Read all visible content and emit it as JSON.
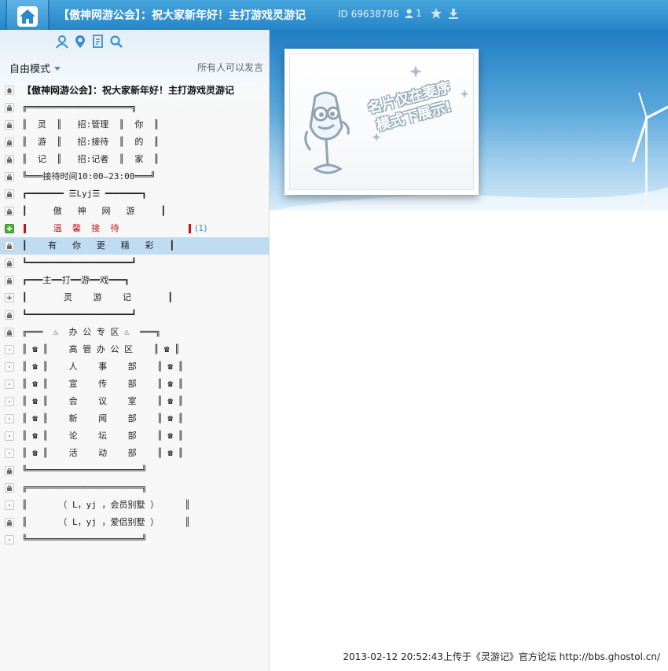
{
  "header": {
    "title": "【傲神网游公会】：祝大家新年好！主打游戏灵游记",
    "room_id": "ID 69638786",
    "user_count": "1",
    "icons": [
      "home-icon",
      "user-icon",
      "star-icon",
      "download-icon"
    ]
  },
  "toolbar": {
    "icons": [
      "user-manage-icon",
      "location-icon",
      "notes-icon",
      "search-icon"
    ]
  },
  "mode_bar": {
    "mode_label": "自由模式",
    "speak_label": "所有人可以发言"
  },
  "channels": [
    {
      "icon": "home",
      "text": "【傲神网游公会】：祝大家新年好！主打游戏灵游记",
      "style": "bold"
    },
    {
      "icon": "lock",
      "text": "╔════════════════════╗"
    },
    {
      "icon": "lock",
      "text": "║  灵  ║   招:管理  ║  你  ║"
    },
    {
      "icon": "lock",
      "text": "║  游  ║   招:接待  ║  的  ║"
    },
    {
      "icon": "lock",
      "text": "║  记  ║   招:记者  ║  家  ║"
    },
    {
      "icon": "lock",
      "text": "╚═══接待时间10:00—23:00═══╝"
    },
    {
      "icon": "lock",
      "text": "┏━━━━━━━ ☰Lyj☰ ━━━━━━━┓"
    },
    {
      "icon": "lock",
      "text": "┃     傲   神   网   游     ┃"
    },
    {
      "icon": "plus-green",
      "text": "      温  馨  接  待        ",
      "style": "red",
      "badge": "(1)"
    },
    {
      "icon": "lock",
      "text": "┃    有   你   更   精   彩   ┃",
      "selected": true
    },
    {
      "icon": "lock",
      "text": "┗━━━━━━━━━━━━━━━━━━━━┛"
    },
    {
      "icon": "lock",
      "text": "┏━━━主━━打━━游━━戏━━━┓"
    },
    {
      "icon": "plus",
      "text": "┃       灵    游    记       ┃"
    },
    {
      "icon": "lock",
      "text": "┗━━━━━━━━━━━━━━━━━━━━┛"
    },
    {
      "icon": "lock",
      "text": "╔═══  ♨  办 公 专 区 ♨  ═══╗"
    },
    {
      "icon": "dot",
      "text": "║ ☎ ║    高 管 办 公 区    ║ ☎ ║"
    },
    {
      "icon": "dot",
      "text": "║ ☎ ║    人    事    部    ║ ☎ ║"
    },
    {
      "icon": "dot",
      "text": "║ ☎ ║    宣    传    部    ║ ☎ ║"
    },
    {
      "icon": "dot",
      "text": "║ ☎ ║    会    议    室    ║ ☎ ║"
    },
    {
      "icon": "dot",
      "text": "║ ☎ ║    新    闻    部    ║ ☎ ║"
    },
    {
      "icon": "dot",
      "text": "║ ☎ ║    论    坛    部    ║ ☎ ║"
    },
    {
      "icon": "dot",
      "text": "║ ☎ ║    活    动    部    ║ ☎ ║"
    },
    {
      "icon": "lock",
      "text": "╚══════════════════════╝"
    },
    {
      "icon": "lock",
      "text": "╔══════════════════════╗"
    },
    {
      "icon": "dot",
      "text": "║      （ L，yj ，会员别墅 ）     ║"
    },
    {
      "icon": "lock",
      "text": "║      （ L，yj ，爱侣别墅 ）     ║"
    },
    {
      "icon": "dot",
      "text": "╚══════════════════════╝"
    }
  ],
  "card": {
    "text_line1": "名片仅在麦序",
    "text_line2": "模式下展示!"
  },
  "footer": {
    "upload_info": "2013-02-12 20:52:43上传于《灵游记》官方论坛 http://bbs.ghostol.cn/"
  },
  "colors": {
    "header_blue": "#2585c6",
    "selected_row": "#bfdcf3",
    "red_text": "#c0141a",
    "badge_blue": "#3a8fd1"
  }
}
